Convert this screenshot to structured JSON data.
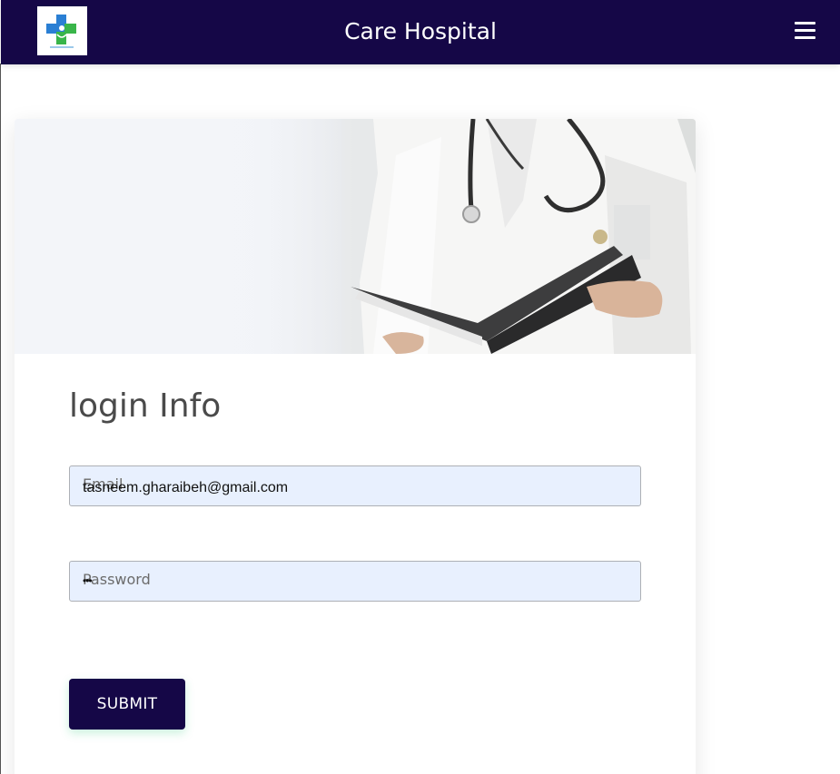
{
  "header": {
    "title": "Care Hospital",
    "logo_icon": "medical-cross-logo",
    "menu_icon": "hamburger-menu-icon",
    "background_color": "#150747",
    "logo_colors": [
      "#2a7fd4",
      "#39b54a"
    ]
  },
  "login": {
    "title": "login Info",
    "email_label": "Email",
    "email_value": "tasneem.gharaibeh@gmail.com",
    "password_label": "Password",
    "password_value": "•••",
    "submit_label": "SUBMIT"
  },
  "hero": {
    "image": "doctor-holding-folder-illustration"
  },
  "theme": {
    "accent": "#150747",
    "input_bg": "#e8f0fe"
  }
}
